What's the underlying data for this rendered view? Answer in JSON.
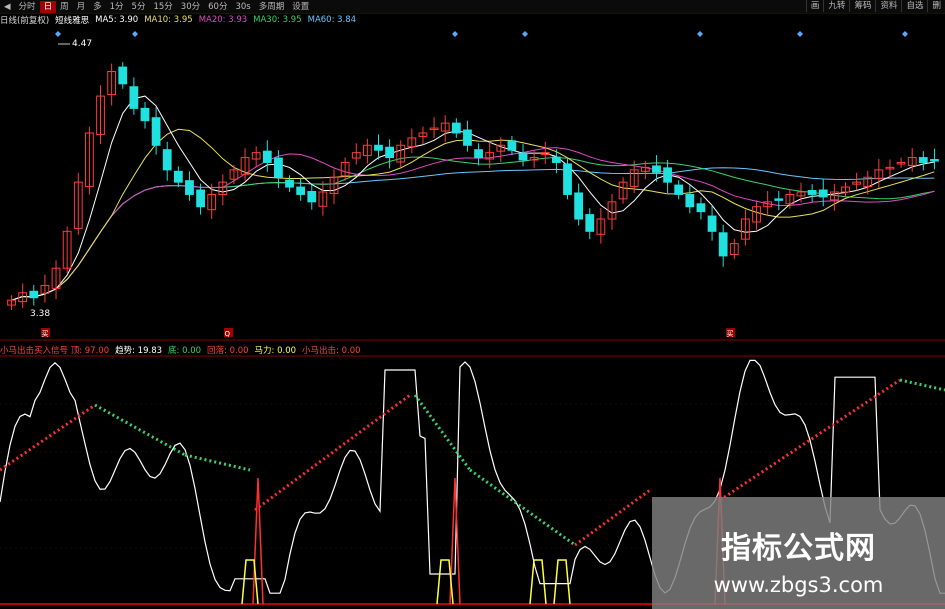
{
  "toolbar": {
    "items": [
      "分时",
      "日",
      "周",
      "月",
      "多",
      "1分",
      "5分",
      "15分",
      "30分",
      "60分",
      "30s",
      "多周期",
      "设置"
    ],
    "active_index": 1,
    "right_items": [
      "画",
      "九转",
      "筹码",
      "资料",
      "自选",
      "删"
    ]
  },
  "main_panel": {
    "stock_label": "日线(前复权)",
    "indicator_name": "短线雅思",
    "ma_labels": [
      {
        "text": "MA5: 3.90",
        "color": "#ffffff"
      },
      {
        "text": "MA10: 3.95",
        "color": "#e8e05a"
      },
      {
        "text": "MA20: 3.93",
        "color": "#e04ac8"
      },
      {
        "text": "MA30: 3.95",
        "color": "#3bd26b"
      },
      {
        "text": "MA60: 3.84",
        "color": "#6ac6ff"
      }
    ],
    "high_label": "4.47",
    "low_label": "3.38",
    "signal_markers": [
      "买",
      "Q",
      "买"
    ],
    "diamond_color": "#5aa8ff"
  },
  "indicator_panel": {
    "labels": [
      {
        "text": "小马出击买入信号 顶: 97.00",
        "color": "#ff4040"
      },
      {
        "text": "趋势: 19.83",
        "color": "#ffffff"
      },
      {
        "text": "底: 0.00",
        "color": "#3bd26b"
      },
      {
        "text": "回落: 0.00",
        "color": "#ff4040"
      },
      {
        "text": "马力: 0.00",
        "color": "#ffff40"
      },
      {
        "text": "小马出击: 0.00",
        "color": "#ff4040"
      }
    ]
  },
  "colors": {
    "up": "#ff3c3c",
    "down": "#20e0e0",
    "ma5": "#ffffff",
    "ma10": "#e8e05a",
    "ma20": "#e04ac8",
    "ma30": "#3bd26b",
    "ma60": "#6ac6ff",
    "grid": "#8a0000"
  },
  "watermark": {
    "title": "指标公式网",
    "url": "www.zbgs3.com"
  },
  "chart_data": {
    "type": "candlestick",
    "price_range": [
      3.38,
      4.47
    ],
    "close_series": [
      3.42,
      3.45,
      3.43,
      3.48,
      3.55,
      3.7,
      3.9,
      4.1,
      4.25,
      4.35,
      4.3,
      4.2,
      4.15,
      4.05,
      3.95,
      3.9,
      3.85,
      3.8,
      3.85,
      3.9,
      3.95,
      4.0,
      4.02,
      3.98,
      3.92,
      3.88,
      3.85,
      3.82,
      3.86,
      3.92,
      3.98,
      4.02,
      4.05,
      4.03,
      4.0,
      4.05,
      4.08,
      4.1,
      4.12,
      4.14,
      4.1,
      4.05,
      4.0,
      4.02,
      4.05,
      4.03,
      3.99,
      4.0,
      4.02,
      3.98,
      3.85,
      3.75,
      3.7,
      3.75,
      3.82,
      3.9,
      3.95,
      3.96,
      3.94,
      3.9,
      3.85,
      3.8,
      3.78,
      3.7,
      3.6,
      3.65,
      3.75,
      3.8,
      3.82,
      3.83,
      3.85,
      3.86,
      3.85,
      3.84,
      3.86,
      3.88,
      3.9,
      3.92,
      3.95,
      3.96,
      3.98,
      4.0,
      3.98,
      3.99
    ]
  }
}
